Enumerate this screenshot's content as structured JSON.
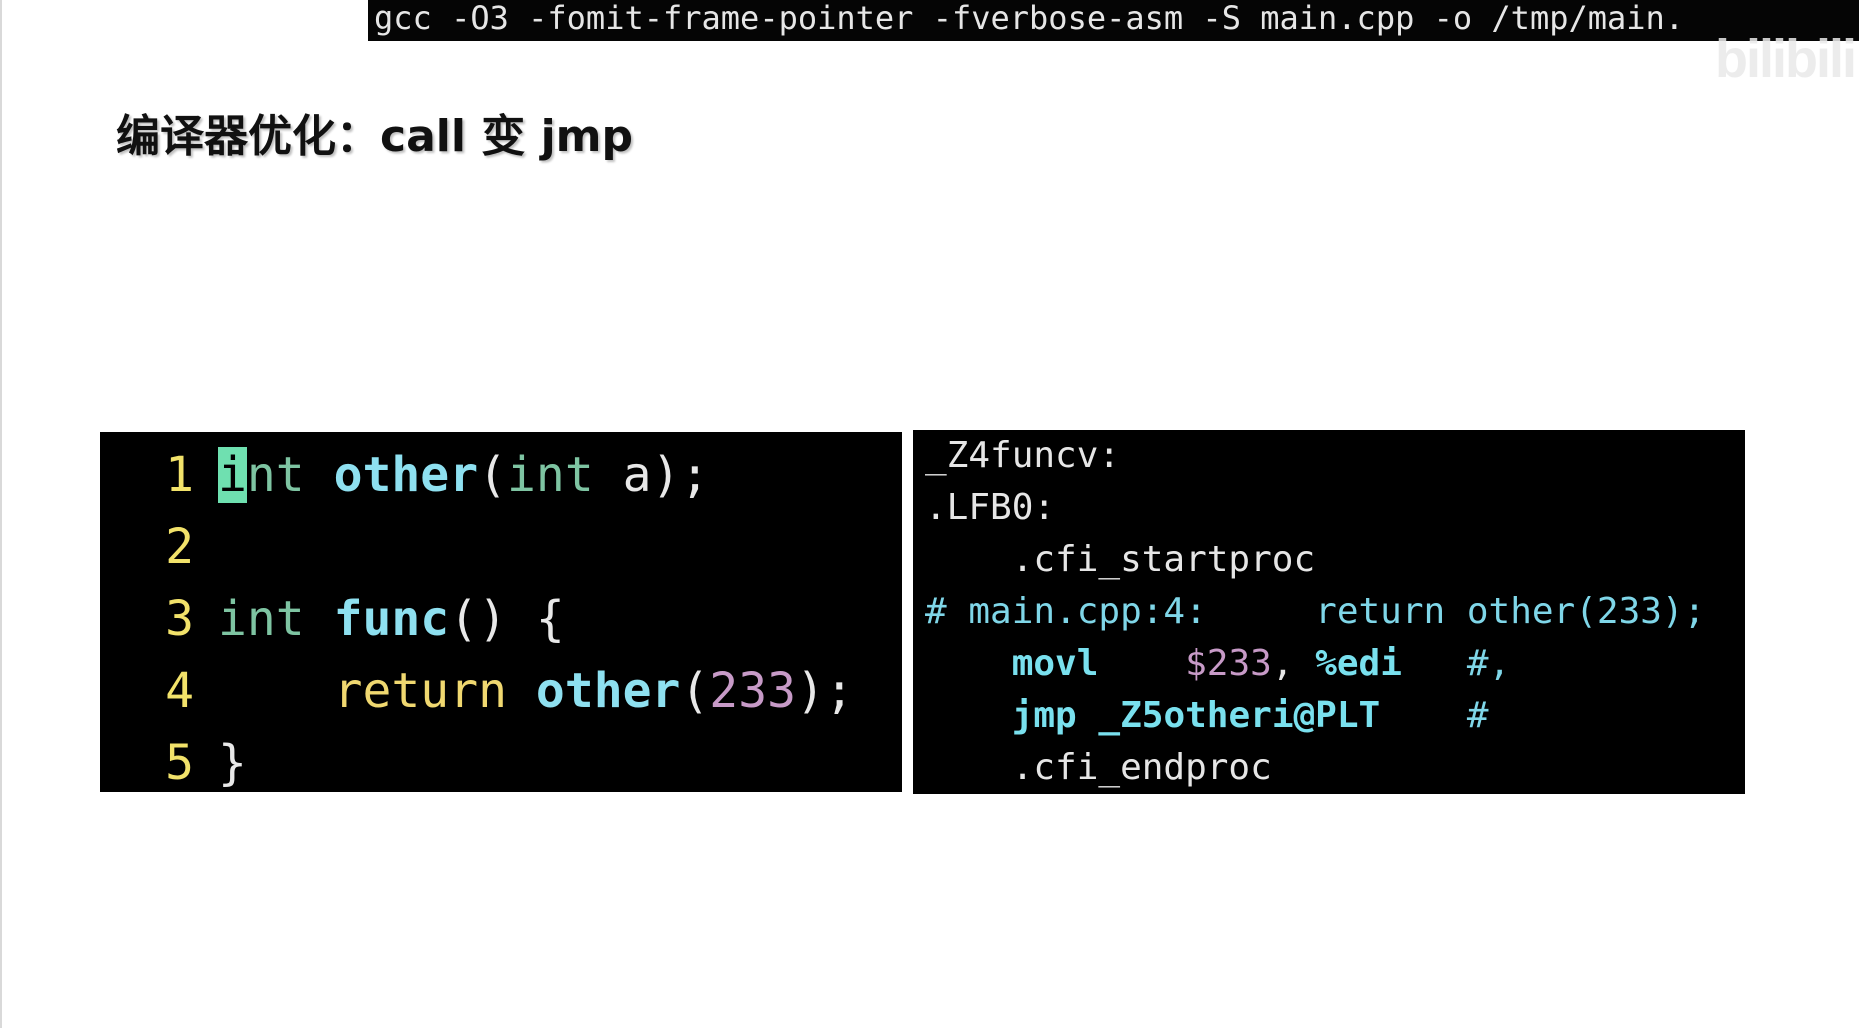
{
  "terminal": {
    "command": "gcc -O3 -fomit-frame-pointer -fverbose-asm -S main.cpp -o /tmp/main."
  },
  "watermark": "bilibili",
  "slide": {
    "title": "编译器优化：call 变 jmp"
  },
  "source_code": {
    "lines": [
      {
        "number": "1",
        "tokens": [
          "i",
          "nt",
          " ",
          "other",
          "(",
          "int",
          " a);"
        ]
      },
      {
        "number": "2"
      },
      {
        "number": "3",
        "tokens": [
          "int",
          " ",
          "func",
          "()",
          " {"
        ]
      },
      {
        "number": "4",
        "tokens": [
          "    ",
          "return",
          " ",
          "other",
          "(",
          "233",
          ");"
        ]
      },
      {
        "number": "5",
        "tokens": [
          "}"
        ]
      }
    ]
  },
  "assembly": {
    "lines": [
      {
        "text": "_Z4funcv:"
      },
      {
        "text": ".LFB0:"
      },
      {
        "text": "    .cfi_startproc"
      },
      {
        "comment": "# main.cpp:4:",
        "source": "return other(233);"
      },
      {
        "mnemonic": "movl",
        "arg1": "$233",
        "sep": ",",
        "arg2": "%edi",
        "tail": "#,"
      },
      {
        "mnemonic": "jmp",
        "target": "_Z5otheri@PLT",
        "tail": "#"
      },
      {
        "text": "    .cfi_endproc"
      }
    ]
  }
}
